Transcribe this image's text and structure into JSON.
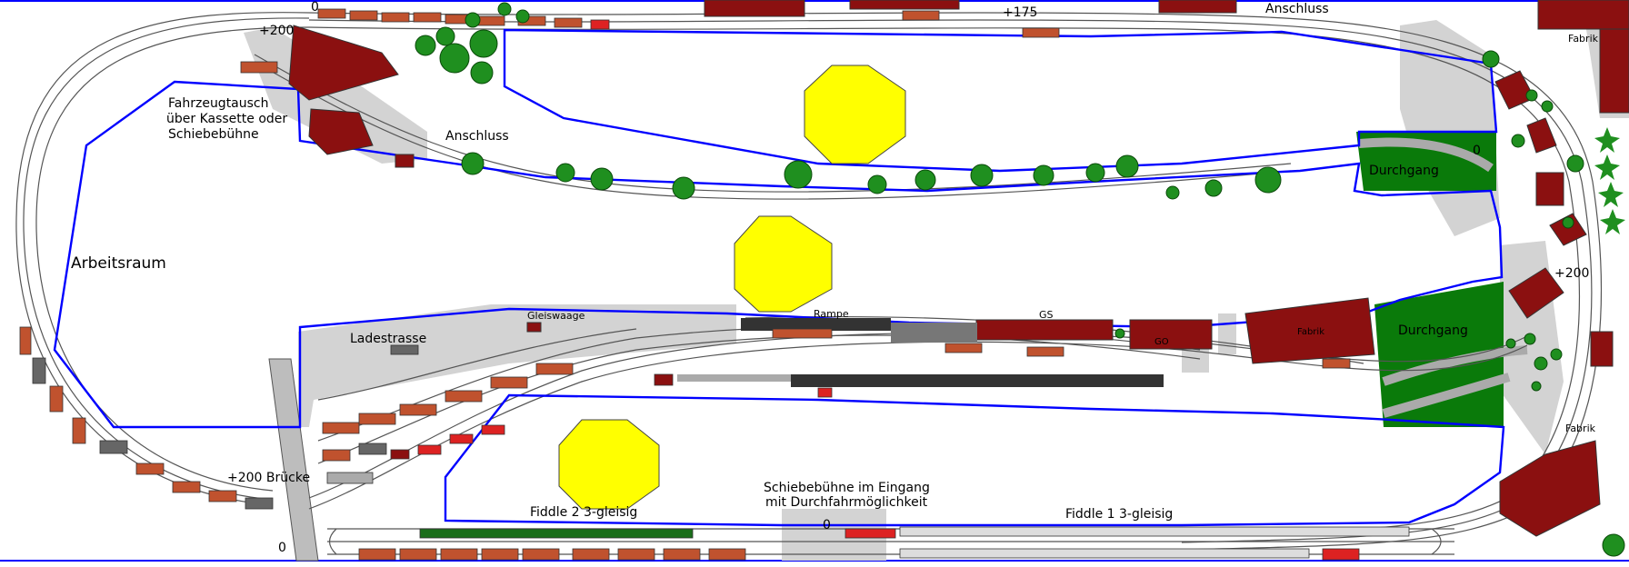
{
  "labels": {
    "arbeitsraum": "Arbeitsraum",
    "fahrzeug_1": "Fahrzeugtausch",
    "fahrzeug_2": "über Kassette oder",
    "fahrzeug_3": "Schiebebühne",
    "anschluss_left": "Anschluss",
    "anschluss_top": "Anschluss",
    "plus175": "+175",
    "plus200_top": "+200",
    "plus200_right": "+200",
    "plus200_bruecke": "+200 Brücke",
    "zero_top": "0",
    "zero_bottom_left": "0",
    "zero_bottom_mid": "0",
    "zero_durchgang": "0",
    "fabrik_top": "Fabrik",
    "fabrik_right": "Fabrik",
    "fabrik_center": "Fabrik",
    "durchgang_top": "Durchgang",
    "durchgang_mid": "Durchgang",
    "ladestrasse": "Ladestrasse",
    "gleiswaage": "Gleiswaage",
    "rampe": "Rampe",
    "gs": "GS",
    "go": "GO",
    "fiddle2": "Fiddle 2 3-gleisig",
    "fiddle1": "Fiddle 1 3-gleisig",
    "schiebe_1": "Schiebebühne im Eingang",
    "schiebe_2": "mit Durchfahrmöglichkeit"
  },
  "colors": {
    "room_border": "#0000ff",
    "track": "#555555",
    "building": "#8b1010",
    "tree": "#1f8f1f",
    "grass": "#0a7a0a",
    "platform": "#cfcfcf",
    "column": "#ffff00",
    "wagon": "#c0522e"
  }
}
